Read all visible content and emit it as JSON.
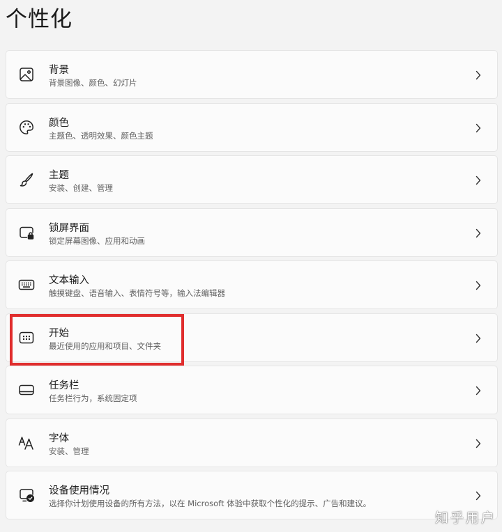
{
  "page": {
    "title": "个性化",
    "watermark": "知乎用户"
  },
  "colors": {
    "background": "#f3f3f3",
    "card": "#fbfbfb",
    "highlight": "#e02d2d"
  },
  "items": [
    {
      "title": "背景",
      "desc": "背景图像、颜色、幻灯片",
      "icon": "image-icon"
    },
    {
      "title": "颜色",
      "desc": "主题色、透明效果、颜色主题",
      "icon": "palette-icon"
    },
    {
      "title": "主题",
      "desc": "安装、创建、管理",
      "icon": "brush-icon"
    },
    {
      "title": "锁屏界面",
      "desc": "锁定屏幕图像、应用和动画",
      "icon": "lock-screen-icon"
    },
    {
      "title": "文本输入",
      "desc": "触摸键盘、语音输入、表情符号等，输入法编辑器",
      "icon": "keyboard-icon"
    },
    {
      "title": "开始",
      "desc": "最近使用的应用和项目、文件夹",
      "icon": "start-menu-icon"
    },
    {
      "title": "任务栏",
      "desc": "任务栏行为，系统固定项",
      "icon": "taskbar-icon"
    },
    {
      "title": "字体",
      "desc": "安装、管理",
      "icon": "font-icon"
    },
    {
      "title": "设备使用情况",
      "desc": "选择你计划使用设备的所有方法，以在 Microsoft 体验中获取个性化的提示、广告和建议。",
      "icon": "device-usage-icon"
    }
  ]
}
